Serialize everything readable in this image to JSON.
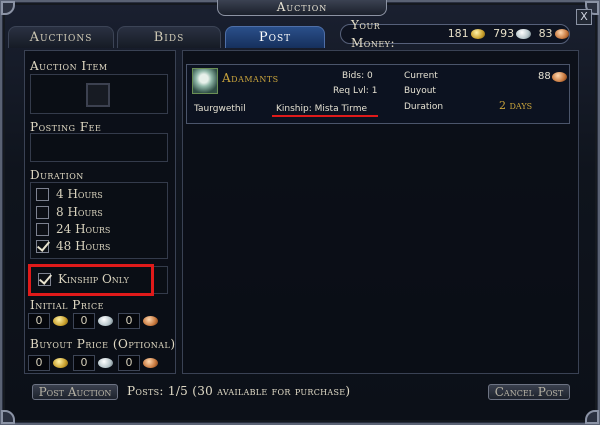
{
  "window": {
    "title": "Auction",
    "close_label": "X"
  },
  "tabs": [
    {
      "label": "Auctions",
      "active": false
    },
    {
      "label": "Bids",
      "active": false
    },
    {
      "label": "Post",
      "active": true
    }
  ],
  "money": {
    "label": "Your Money:",
    "gold": "181",
    "silver": "793",
    "copper": "83"
  },
  "left": {
    "auction_item_label": "Auction Item",
    "posting_fee_label": "Posting Fee",
    "duration_label": "Duration",
    "durations": [
      {
        "label": "4 Hours",
        "checked": false
      },
      {
        "label": "8 Hours",
        "checked": false
      },
      {
        "label": "24 Hours",
        "checked": false
      },
      {
        "label": "48 Hours",
        "checked": true
      }
    ],
    "kinship_only_label": "Kinship Only",
    "kinship_only_checked": true,
    "initial_price_label": "Initial Price",
    "initial_price": {
      "gold": "0",
      "silver": "0",
      "copper": "0"
    },
    "buyout_price_label": "Buyout Price (Optional)",
    "buyout_price": {
      "gold": "0",
      "silver": "0",
      "copper": "0"
    }
  },
  "listing": {
    "item_name": "Adamants",
    "seller": "Taurgwethil",
    "kinship": "Kinship: Mista Tirme",
    "bids_label": "Bids: 0",
    "req_lvl_label": "Req Lvl: 1",
    "current_label": "Current",
    "current_value": "88",
    "buyout_label": "Buyout",
    "duration_label": "Duration",
    "duration_value": "2 days"
  },
  "footer": {
    "post_button": "Post Auction",
    "posts_status": "Posts: 1/5 (30 available for purchase)",
    "cancel_button": "Cancel Post"
  },
  "colors": {
    "highlight_red": "#e01a1a",
    "active_tab": "#2a4f8a",
    "gold_text": "#c9a43c"
  }
}
